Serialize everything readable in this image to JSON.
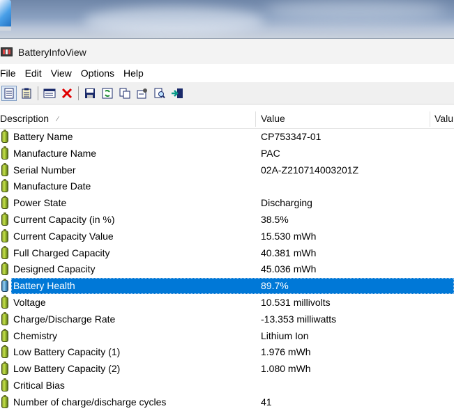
{
  "window": {
    "title": "BatteryInfoView"
  },
  "menu": [
    "File",
    "Edit",
    "View",
    "Options",
    "Help"
  ],
  "toolbar": {
    "buttons": [
      "properties-view-icon",
      "clipboard-view-icon",
      "window-icon",
      "delete-icon",
      "save-icon",
      "refresh-icon",
      "copy-icon",
      "properties-icon",
      "find-icon",
      "exit-icon"
    ]
  },
  "columns": {
    "description": "Description",
    "value": "Value",
    "value2": "Valu"
  },
  "rows": [
    {
      "description": "Battery Name",
      "value": "CP753347-01"
    },
    {
      "description": "Manufacture Name",
      "value": "PAC"
    },
    {
      "description": "Serial Number",
      "value": "02A-Z210714003201Z"
    },
    {
      "description": "Manufacture Date",
      "value": ""
    },
    {
      "description": "Power State",
      "value": "Discharging"
    },
    {
      "description": "Current Capacity (in %)",
      "value": "38.5%"
    },
    {
      "description": "Current Capacity Value",
      "value": "15.530 mWh"
    },
    {
      "description": "Full Charged Capacity",
      "value": "40.381 mWh"
    },
    {
      "description": "Designed Capacity",
      "value": "45.036 mWh"
    },
    {
      "description": "Battery Health",
      "value": "89.7%",
      "selected": true
    },
    {
      "description": "Voltage",
      "value": "10.531 millivolts"
    },
    {
      "description": "Charge/Discharge Rate",
      "value": "-13.353 milliwatts"
    },
    {
      "description": "Chemistry",
      "value": "Lithium Ion"
    },
    {
      "description": "Low Battery Capacity (1)",
      "value": "1.976 mWh"
    },
    {
      "description": "Low Battery Capacity (2)",
      "value": "1.080 mWh"
    },
    {
      "description": "Critical Bias",
      "value": ""
    },
    {
      "description": "Number of charge/discharge cycles",
      "value": "41"
    }
  ],
  "colors": {
    "selection": "#0078d7",
    "battery_icon": "#9cbf2f"
  }
}
